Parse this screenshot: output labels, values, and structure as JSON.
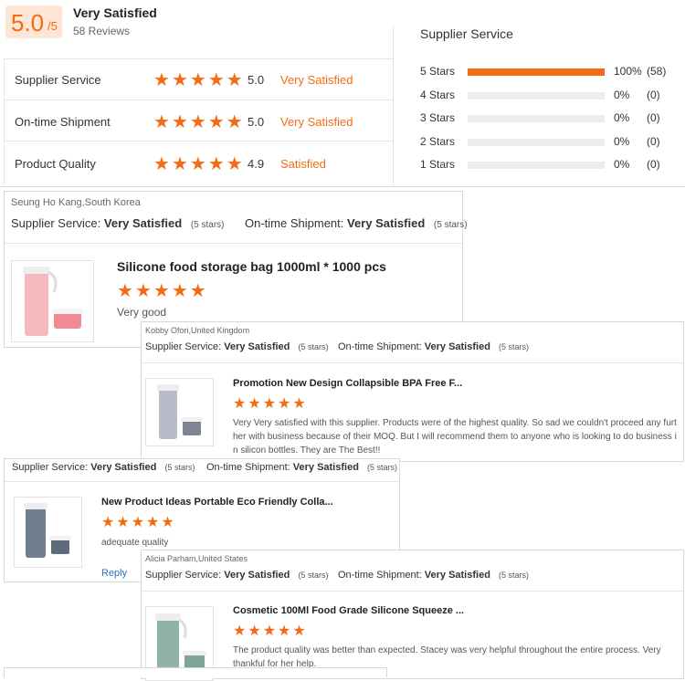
{
  "summary": {
    "score": "5.0",
    "score_max": "/5",
    "label": "Very Satisfied",
    "reviews": "58 Reviews"
  },
  "metrics": [
    {
      "name": "Supplier Service",
      "value": "5.0",
      "label": "Very Satisfied",
      "stars": 5
    },
    {
      "name": "On-time Shipment",
      "value": "5.0",
      "label": "Very Satisfied",
      "stars": 5
    },
    {
      "name": "Product Quality",
      "value": "4.9",
      "label": "Satisfied",
      "stars": 5
    }
  ],
  "breakdown": {
    "title": "Supplier Service",
    "rows": [
      {
        "label": "5 Stars",
        "percent": "100%",
        "count": "(58)",
        "fraction": 1.0
      },
      {
        "label": "4 Stars",
        "percent": "0%",
        "count": "(0)",
        "fraction": 0
      },
      {
        "label": "3 Stars",
        "percent": "0%",
        "count": "(0)",
        "fraction": 0
      },
      {
        "label": "2 Stars",
        "percent": "0%",
        "count": "(0)",
        "fraction": 0
      },
      {
        "label": "1 Stars",
        "percent": "0%",
        "count": "(0)",
        "fraction": 0
      }
    ]
  },
  "common": {
    "supplier_service_label": "Supplier Service:",
    "ontime_label": "On-time Shipment:",
    "very_satisfied": "Very Satisfied",
    "five_stars": "(5 stars)",
    "reply": "Reply"
  },
  "reviews": [
    {
      "reviewer": "Seung Ho Kang,South Korea",
      "product": "Silicone food storage bag 1000ml * 1000 pcs",
      "comment": "Very good"
    },
    {
      "reviewer": "Kobby Ofori,United Kingdom",
      "product": "Promotion New Design Collapsible BPA Free F...",
      "comment": "Very Very satisfied with this supplier. Products were of the highest quality. So sad we couldn't proceed any further with business because of their MOQ. But I will recommend them to anyone who is looking to do business in silicon bottles. They are The Best!!"
    },
    {
      "reviewer": "",
      "product": "New Product Ideas Portable Eco Friendly Colla...",
      "comment": "adequate quality"
    },
    {
      "reviewer": "Alicia Parham,United States",
      "product": "Cosmetic 100Ml Food Grade Silicone Squeeze ...",
      "comment": "The product quality was better than expected.  Stacey was very helpful throughout the entire process.  Very thankful for her help."
    }
  ],
  "colors": {
    "accent": "#f36c15",
    "score_bg": "#fde6d6",
    "link": "#2a6ebb"
  }
}
